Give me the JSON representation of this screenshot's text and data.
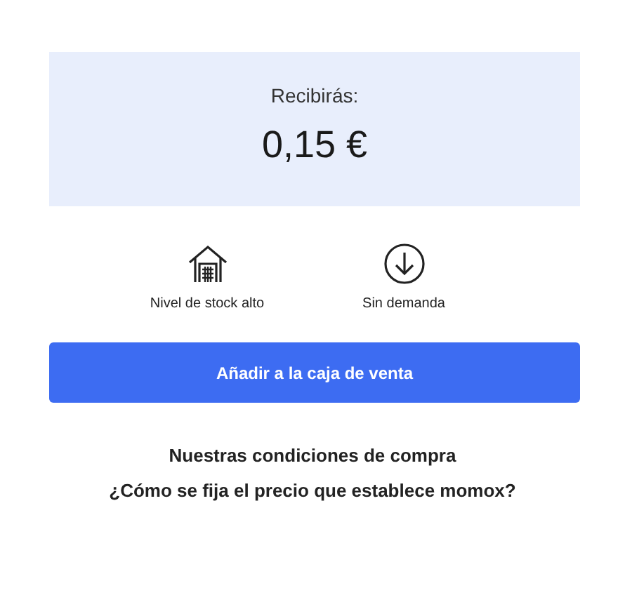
{
  "price_card": {
    "label": "Recibirás:",
    "amount": "0,15 €"
  },
  "indicators": [
    {
      "kind": "warehouse",
      "label": "Nivel de stock alto"
    },
    {
      "kind": "down",
      "label": "Sin demanda"
    }
  ],
  "add_button": "Añadir a la caja de venta",
  "links": [
    "Nuestras condiciones de compra",
    "¿Cómo se fija el precio que establece momox?"
  ]
}
